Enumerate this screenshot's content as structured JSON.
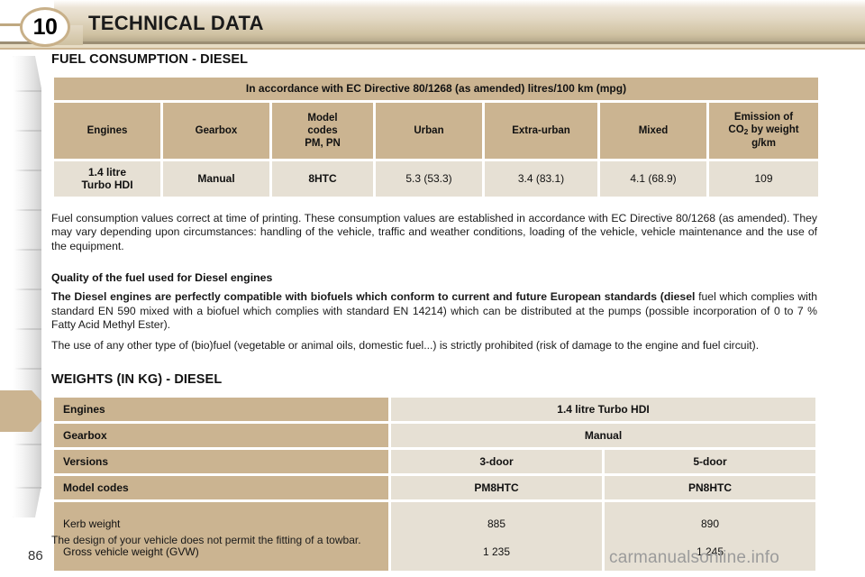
{
  "header": {
    "chapter_number": "10",
    "title": "TECHNICAL DATA"
  },
  "fuel_section": {
    "title": "FUEL CONSUMPTION - DIESEL",
    "table": {
      "caption": "In accordance with EC Directive 80/1268 (as amended) litres/100 km (mpg)",
      "headers": [
        "Engines",
        "Gearbox",
        "Model\ncodes\nPM, PN",
        "Urban",
        "Extra-urban",
        "Mixed",
        "Emission of\nCO2 by weight\ng/km"
      ],
      "header_model_codes_line1": "Model",
      "header_model_codes_line2": "codes",
      "header_model_codes_line3": "PM, PN",
      "header_emission_line1": "Emission of",
      "header_emission_co2_pre": "CO",
      "header_emission_co2_sub": "2",
      "header_emission_co2_post": " by weight",
      "header_emission_line3": "g/km",
      "row": {
        "engine_line1": "1.4 litre",
        "engine_line2": "Turbo HDI",
        "gearbox": "Manual",
        "model_codes": "8HTC",
        "urban": "5.3 (53.3)",
        "extra_urban": "3.4 (83.1)",
        "mixed": "4.1 (68.9)",
        "co2": "109"
      }
    },
    "note": "Fuel consumption values correct at time of printing. These consumption values are established in accordance with EC Directive 80/1268 (as amended). They may vary depending upon circumstances: handling of the vehicle, traffic and weather conditions, loading of the vehicle, vehicle maintenance and the use of the equipment."
  },
  "quality_section": {
    "heading": "Quality of the fuel used for Diesel engines",
    "paragraph1_bold": "The Diesel engines are perfectly compatible with biofuels which conform to current and future European standards (diesel ",
    "paragraph1_rest": "fuel which complies with standard EN 590 mixed with a biofuel which complies with standard EN 14214) which can be distributed at the pumps (possible incorporation of 0 to 7 % Fatty Acid Methyl Ester).",
    "paragraph2": "The use of any other type of (bio)fuel (vegetable or animal oils, domestic fuel...) is strictly prohibited (risk of damage to the engine and fuel circuit)."
  },
  "weights_section": {
    "title": "WEIGHTS (IN KG) - DIESEL",
    "rows": [
      {
        "label": "Engines",
        "value_full": "1.4 litre Turbo HDI"
      },
      {
        "label": "Gearbox",
        "value_full": "Manual"
      },
      {
        "label": "Versions",
        "value_left": "3-door",
        "value_right": "5-door"
      },
      {
        "label": "Model codes",
        "value_left": "PM8HTC",
        "value_right": "PN8HTC"
      }
    ],
    "weight_rows": {
      "label_line1": "Kerb weight",
      "label_line2": "Gross vehicle weight (GVW)",
      "col_left_line1": "885",
      "col_left_line2": "1 235",
      "col_right_line1": "890",
      "col_right_line2": "1 245"
    }
  },
  "footer": {
    "footnote": "The design of your vehicle does not permit the fitting of a towbar.",
    "page_number": "86",
    "watermark": "carmanualsonline.info"
  },
  "colors": {
    "header_cell": "#cbb491",
    "value_cell": "#e6e0d4",
    "badge_border": "#c8b089"
  }
}
